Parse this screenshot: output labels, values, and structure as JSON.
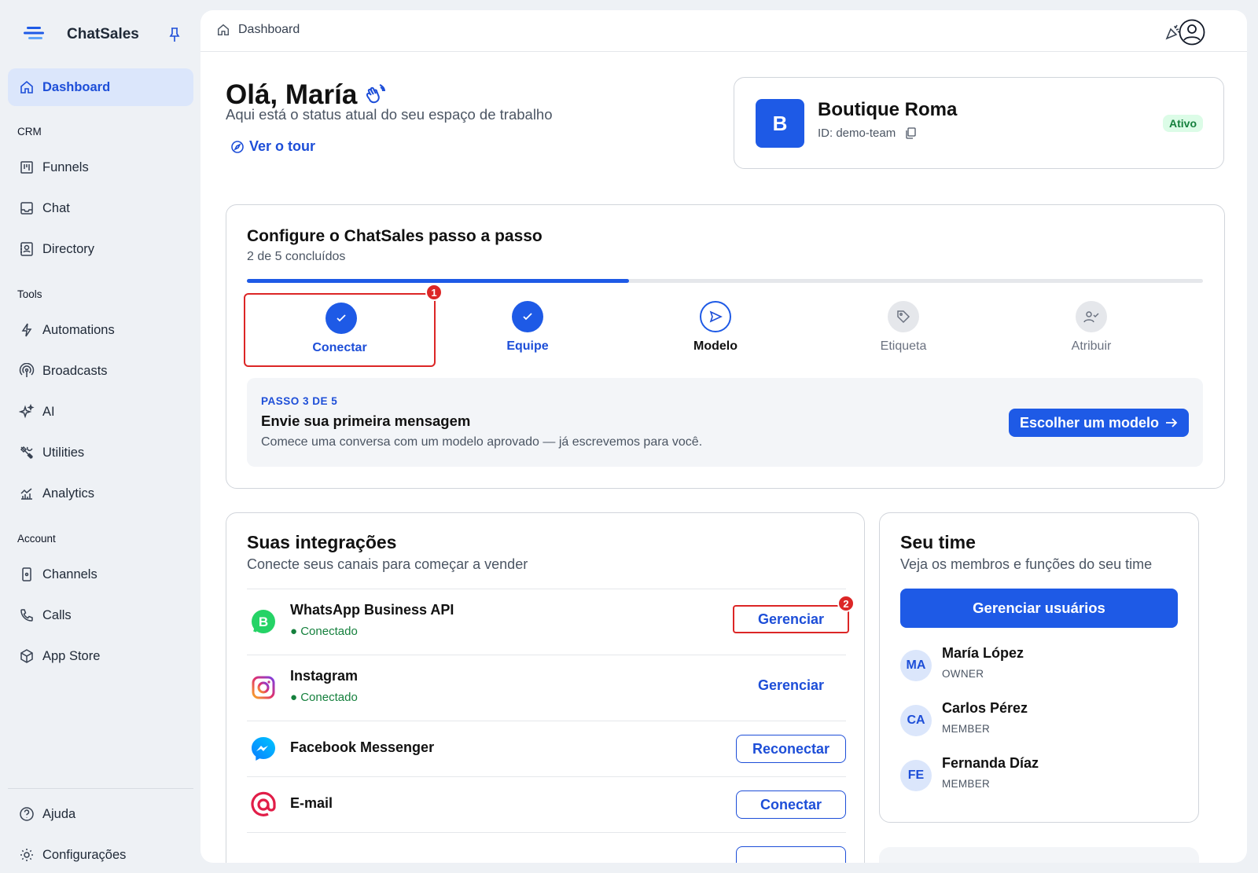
{
  "app": {
    "name": "ChatSales"
  },
  "sidebar": {
    "dashboard": "Dashboard",
    "sections": {
      "crm": "CRM",
      "tools": "Tools",
      "account": "Account"
    },
    "crm_items": [
      "Funnels",
      "Chat",
      "Directory"
    ],
    "tools_items": [
      "Automations",
      "Broadcasts",
      "AI",
      "Utilities",
      "Analytics"
    ],
    "account_items": [
      "Channels",
      "Calls",
      "App Store"
    ],
    "footer_items": [
      "Ajuda",
      "Configurações"
    ]
  },
  "topbar": {
    "breadcrumb": "Dashboard"
  },
  "greeting": {
    "title": "Olá, María",
    "subtitle": "Aqui está o status atual do seu espaço de trabalho",
    "tour_link": "Ver o tour"
  },
  "workspace": {
    "avatar_letter": "B",
    "name": "Boutique Roma",
    "id_label": "ID: demo-team",
    "status": "Ativo"
  },
  "setup": {
    "title": "Configure o ChatSales passo a passo",
    "progress_text": "2 de 5 concluídos",
    "progress_fraction": 0.4,
    "steps": [
      {
        "label": "Conectar",
        "state": "done"
      },
      {
        "label": "Equipe",
        "state": "done"
      },
      {
        "label": "Modelo",
        "state": "current"
      },
      {
        "label": "Etiqueta",
        "state": "todo"
      },
      {
        "label": "Atribuir",
        "state": "todo"
      }
    ],
    "step_badge": "1",
    "current": {
      "kicker": "PASSO 3 DE 5",
      "title": "Envie sua primeira mensagem",
      "description": "Comece uma conversa com um modelo aprovado — já escrevemos para você.",
      "cta": "Escolher um modelo"
    }
  },
  "integrations": {
    "title": "Suas integrações",
    "subtitle": "Conecte seus canais para começar a vender",
    "items": [
      {
        "name": "WhatsApp Business API",
        "status": "● Conectado",
        "action": "Gerenciar",
        "icon": "whatsapp-business-icon",
        "badge": "2"
      },
      {
        "name": "Instagram",
        "status": "● Conectado",
        "action": "Gerenciar",
        "icon": "instagram-icon"
      },
      {
        "name": "Facebook Messenger",
        "status": "",
        "action": "Reconectar",
        "icon": "messenger-icon"
      },
      {
        "name": "E-mail",
        "status": "",
        "action": "Conectar",
        "icon": "email-at-icon"
      }
    ]
  },
  "team": {
    "title": "Seu time",
    "subtitle": "Veja os membros e funções do seu time",
    "manage_button": "Gerenciar usuários",
    "members": [
      {
        "initials": "MA",
        "name": "María López",
        "role": "OWNER"
      },
      {
        "initials": "CA",
        "name": "Carlos Pérez",
        "role": "MEMBER"
      },
      {
        "initials": "FE",
        "name": "Fernanda Díaz",
        "role": "MEMBER"
      }
    ]
  },
  "colors": {
    "accent": "#1e5ae6",
    "success": "#15803d",
    "danger": "#dc2626"
  }
}
